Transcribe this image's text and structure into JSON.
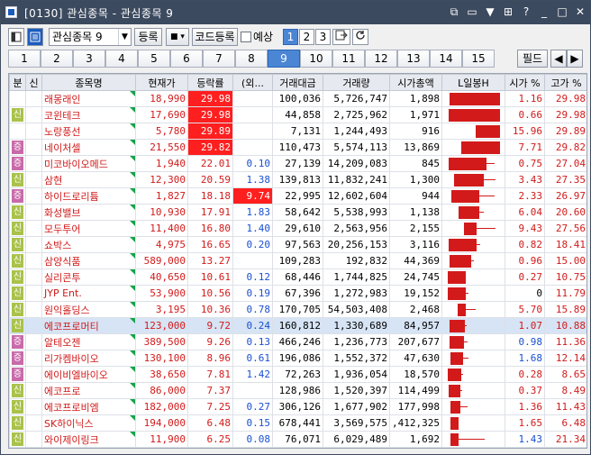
{
  "window": {
    "title": "[0130] 관심종목 - 관심종목 9",
    "controls": [
      "⧉",
      "▭",
      "▼",
      "⊞",
      "?",
      "_",
      "□",
      "✕"
    ]
  },
  "toolbar": {
    "group_select": "관심종목 9",
    "register_label": "등록",
    "code_register_label": "코드등록",
    "preview_label": "예상",
    "pages": [
      "1",
      "2",
      "3"
    ],
    "active_page": "1"
  },
  "tabs": {
    "items": [
      "1",
      "2",
      "3",
      "4",
      "5",
      "6",
      "7",
      "8",
      "9",
      "10",
      "11",
      "12",
      "13",
      "14",
      "15"
    ],
    "active": "9",
    "field_label": "필드"
  },
  "colors": {
    "up": "#d21a1a",
    "down": "#1a4fd2",
    "highlight": "#ff1f1f",
    "selected": "#d6e4f5"
  },
  "table": {
    "headers": [
      "분",
      "신",
      "종목명",
      "현재가",
      "등락률",
      "(외...",
      "거래대금",
      "거래량",
      "시가총액",
      "L일봉H",
      "시가 %",
      "고가 %"
    ],
    "rows": [
      {
        "flag": "",
        "name": "래몽래인",
        "price": "18,990",
        "rate": "29.98",
        "foreign": "",
        "value": "100,036",
        "volume": "5,726,747",
        "cap": "1,898",
        "open": "1.16",
        "high": "29.98",
        "rate_hi": true
      },
      {
        "flag": "신",
        "name": "코윈테크",
        "price": "17,690",
        "rate": "29.98",
        "foreign": "",
        "value": "44,858",
        "volume": "2,725,962",
        "cap": "1,971",
        "open": "0.66",
        "high": "29.98",
        "rate_hi": true
      },
      {
        "flag": "",
        "name": "노랑풍선",
        "price": "5,780",
        "rate": "29.89",
        "foreign": "",
        "value": "7,131",
        "volume": "1,244,493",
        "cap": "916",
        "open": "15.96",
        "high": "29.89",
        "rate_hi": true
      },
      {
        "flag": "증",
        "name": "네이처셀",
        "price": "21,550",
        "rate": "29.82",
        "foreign": "",
        "value": "110,473",
        "volume": "5,574,113",
        "cap": "13,869",
        "open": "7.71",
        "high": "29.82",
        "rate_hi": true
      },
      {
        "flag": "증",
        "name": "미코바이오메드",
        "price": "1,940",
        "rate": "22.01",
        "foreign": "0.10",
        "value": "27,139",
        "volume": "14,209,083",
        "cap": "845",
        "open": "0.75",
        "high": "27.04"
      },
      {
        "flag": "신",
        "name": "삼현",
        "price": "12,300",
        "rate": "20.59",
        "foreign": "1.38",
        "value": "139,813",
        "volume": "11,832,241",
        "cap": "1,300",
        "open": "3.43",
        "high": "27.35"
      },
      {
        "flag": "증",
        "name": "하이드로리튬",
        "price": "1,827",
        "rate": "18.18",
        "foreign": "9.74",
        "value": "22,995",
        "volume": "12,602,604",
        "cap": "944",
        "open": "2.33",
        "high": "26.97",
        "foreign_hi": true
      },
      {
        "flag": "신",
        "name": "화성밸브",
        "price": "10,930",
        "rate": "17.91",
        "foreign": "1.83",
        "value": "58,642",
        "volume": "5,538,993",
        "cap": "1,138",
        "open": "6.04",
        "high": "20.60"
      },
      {
        "flag": "신",
        "name": "모두투어",
        "price": "11,400",
        "rate": "16.80",
        "foreign": "1.40",
        "value": "29,610",
        "volume": "2,563,956",
        "cap": "2,155",
        "open": "9.43",
        "high": "27.56"
      },
      {
        "flag": "신",
        "name": "쇼박스",
        "price": "4,975",
        "rate": "16.65",
        "foreign": "0.20",
        "value": "97,563",
        "volume": "20,256,153",
        "cap": "3,116",
        "open": "0.82",
        "high": "18.41"
      },
      {
        "flag": "신",
        "name": "삼양식품",
        "price": "589,000",
        "rate": "13.27",
        "foreign": "",
        "value": "109,283",
        "volume": "192,832",
        "cap": "44,369",
        "open": "0.96",
        "high": "15.00"
      },
      {
        "flag": "신",
        "name": "실리콘투",
        "price": "40,650",
        "rate": "10.61",
        "foreign": "0.12",
        "value": "68,446",
        "volume": "1,744,825",
        "cap": "24,745",
        "open": "0.27",
        "high": "10.75"
      },
      {
        "flag": "신",
        "name": "JYP Ent.",
        "price": "53,900",
        "rate": "10.56",
        "foreign": "0.19",
        "value": "67,396",
        "volume": "1,272,983",
        "cap": "19,152",
        "open": "0",
        "high": "11.79"
      },
      {
        "flag": "신",
        "name": "원익홀딩스",
        "price": "3,195",
        "rate": "10.36",
        "foreign": "0.78",
        "value": "170,705",
        "volume": "54,503,408",
        "cap": "2,468",
        "open": "5.70",
        "high": "15.89"
      },
      {
        "flag": "신",
        "name": "에코프로머티",
        "price": "123,000",
        "rate": "9.72",
        "foreign": "0.24",
        "value": "160,812",
        "volume": "1,330,689",
        "cap": "84,957",
        "open": "1.07",
        "high": "10.88",
        "selected": true
      },
      {
        "flag": "증",
        "name": "알테오젠",
        "price": "389,500",
        "rate": "9.26",
        "foreign": "0.13",
        "value": "466,246",
        "volume": "1,236,773",
        "cap": "207,677",
        "open": "0.98",
        "high": "11.36",
        "open_blue": true
      },
      {
        "flag": "증",
        "name": "리가켐바이오",
        "price": "130,100",
        "rate": "8.96",
        "foreign": "0.61",
        "value": "196,086",
        "volume": "1,552,372",
        "cap": "47,630",
        "open": "1.68",
        "high": "12.14",
        "open_blue": true
      },
      {
        "flag": "증",
        "name": "에이비엘바이오",
        "price": "38,650",
        "rate": "7.81",
        "foreign": "1.42",
        "value": "72,263",
        "volume": "1,936,054",
        "cap": "18,570",
        "open": "0.28",
        "high": "8.65"
      },
      {
        "flag": "신",
        "name": "에코프로",
        "price": "86,000",
        "rate": "7.37",
        "foreign": "",
        "value": "128,986",
        "volume": "1,520,397",
        "cap": "114,499",
        "open": "0.37",
        "high": "8.49"
      },
      {
        "flag": "신",
        "name": "에코프로비엠",
        "price": "182,000",
        "rate": "7.25",
        "foreign": "0.27",
        "value": "306,126",
        "volume": "1,677,902",
        "cap": "177,998",
        "open": "1.36",
        "high": "11.43"
      },
      {
        "flag": "신",
        "name": "SK하이닉스",
        "price": "194,000",
        "rate": "6.48",
        "foreign": "0.15",
        "value": "678,441",
        "volume": "3,569,575",
        "cap": ",412,325",
        "open": "1.65",
        "high": "6.48"
      },
      {
        "flag": "신",
        "name": "와이제이링크",
        "price": "11,900",
        "rate": "6.25",
        "foreign": "0.08",
        "value": "76,071",
        "volume": "6,029,489",
        "cap": "1,692",
        "open": "1.43",
        "high": "21.34",
        "open_blue": true
      }
    ]
  }
}
